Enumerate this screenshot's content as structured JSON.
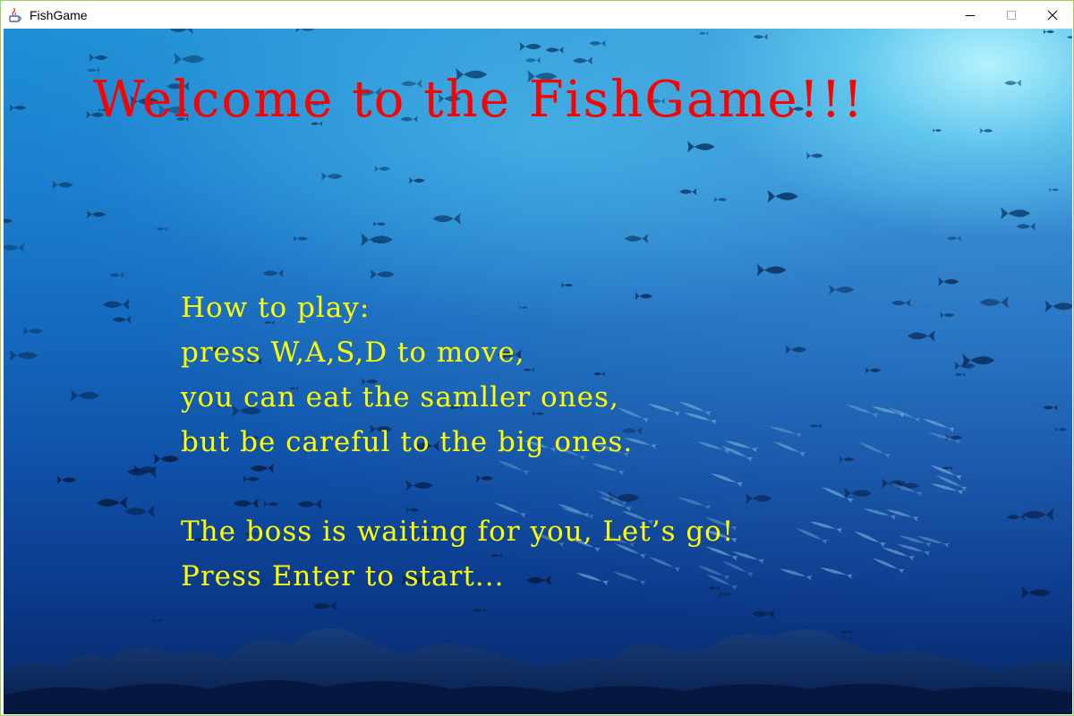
{
  "window": {
    "title": "FishGame",
    "controls": {
      "minimize_icon": "minimize-icon",
      "maximize_icon": "maximize-icon",
      "close_icon": "close-icon"
    }
  },
  "game": {
    "welcome": "Welcome to the FishGame!!!",
    "instructions": {
      "heading": "How to play:",
      "line1": "press W,A,S,D to move,",
      "line2": "you can eat the samller ones,",
      "line3": "but be careful to the big ones.",
      "line4": "The boss is waiting for you, Let’s go!",
      "line5": "Press Enter to start..."
    }
  },
  "colors": {
    "title_text": "#ff0000",
    "instruction_text": "#ffff00",
    "water_top": "#1d8fd6",
    "water_bottom": "#072866"
  }
}
